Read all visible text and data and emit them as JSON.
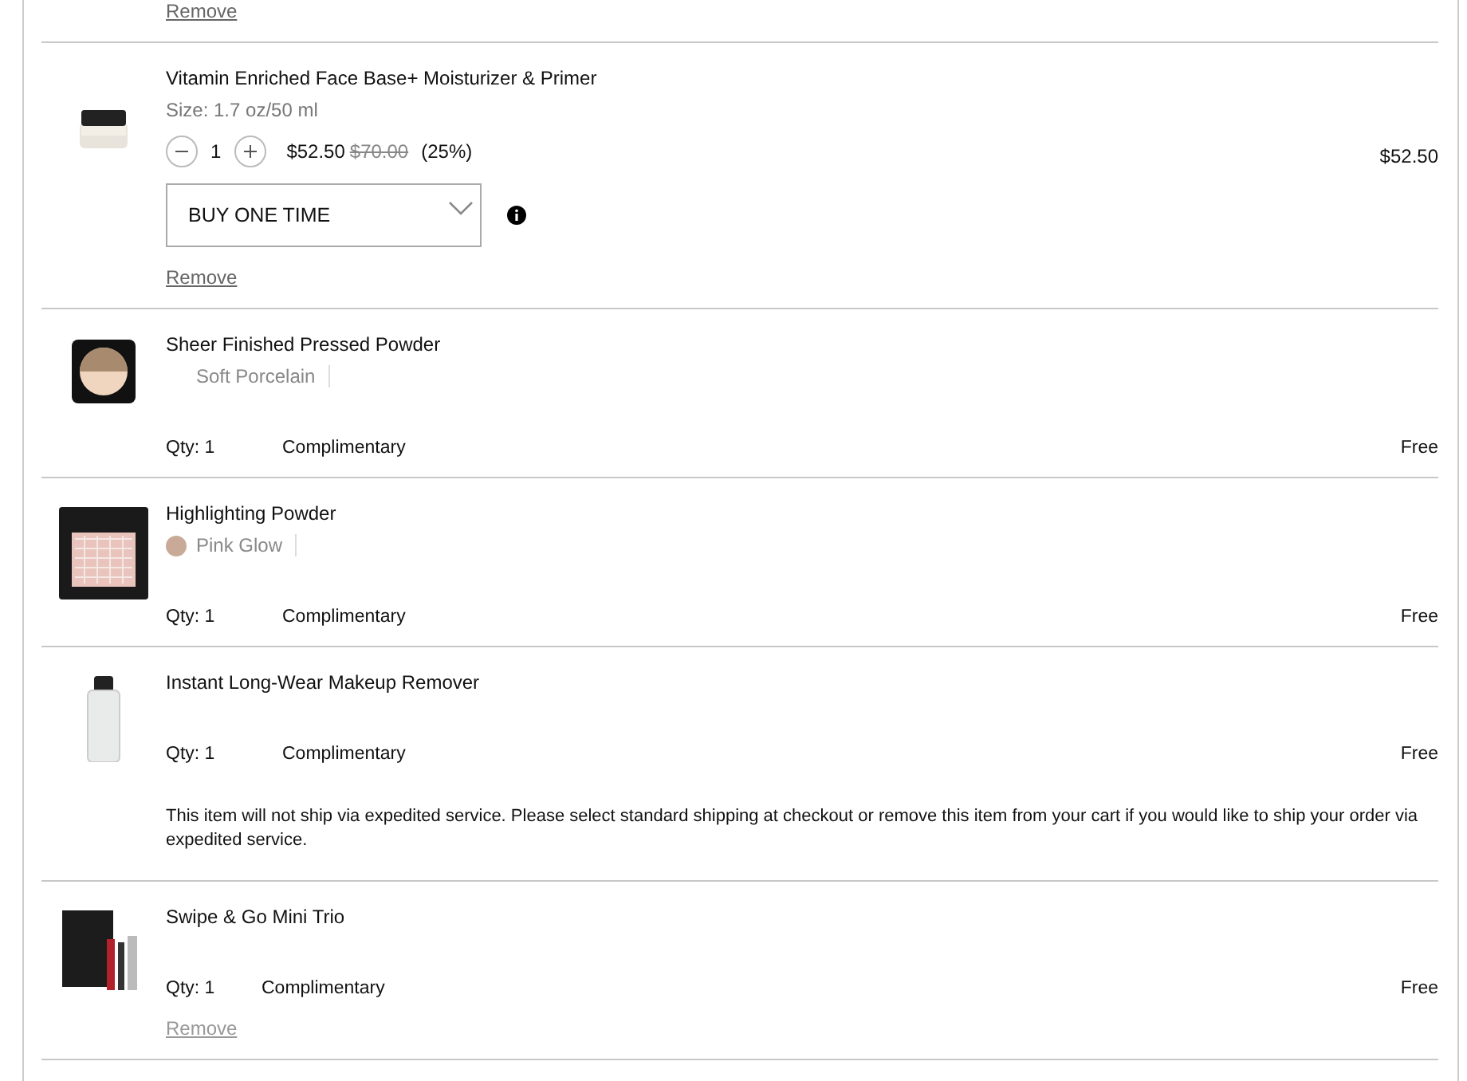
{
  "top_link": "Remove",
  "items": [
    {
      "kind": "subscription",
      "name": "Vitamin Enriched Face Base+ Moisturizer & Primer",
      "size": "Size: 1.7 oz/50 ml",
      "quantity": "1",
      "price": "$52.50",
      "original_price": "$70.00",
      "discount": "(25%)",
      "total": "$52.50",
      "purchase_option": "BUY ONE TIME",
      "remove": "Remove"
    },
    {
      "kind": "gift",
      "name": "Sheer Finished Pressed Powder",
      "shade": "Soft Porcelain",
      "quantity": "Qty: 1",
      "price": "Complimentary",
      "total": "Free"
    },
    {
      "kind": "gift",
      "name": "Highlighting Powder",
      "shade": "Pink Glow",
      "color": "#c9aa99",
      "quantity": "Qty: 1",
      "price": "Complimentary",
      "total": "Free"
    },
    {
      "kind": "gift",
      "name": "Instant Long-Wear Makeup Remover",
      "quantity": "Qty: 1",
      "price": "Complimentary",
      "total": "Free",
      "note": "This item will not ship via expedited service. Please select standard shipping at checkout or remove this item from your cart if you would like to ship your order via expedited service."
    },
    {
      "kind": "gift",
      "name": "Swipe & Go Mini Trio",
      "quantity": "Qty: 1",
      "price": "Complimentary",
      "total": "Free",
      "remove": "Remove"
    }
  ]
}
